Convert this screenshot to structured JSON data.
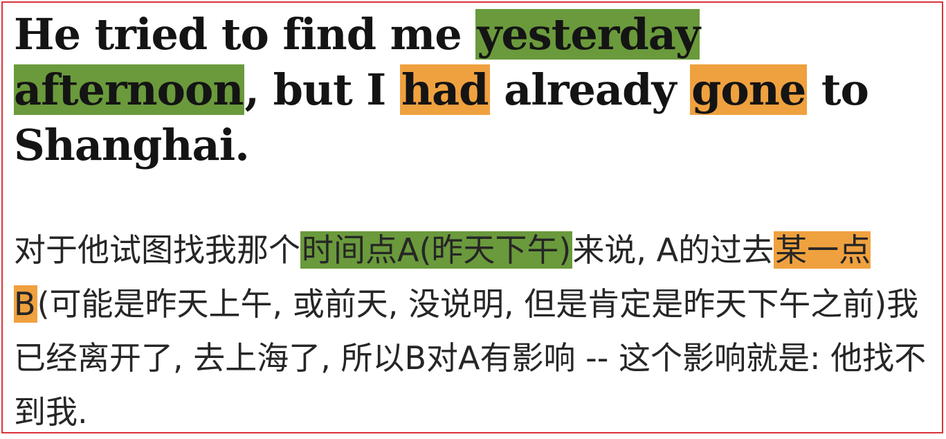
{
  "colors": {
    "border": "#d9323b",
    "highlight_time": "#6a9a3c",
    "highlight_verb": "#efa13f",
    "text": "#141414"
  },
  "english": {
    "seg1": "He tried to find me ",
    "hl_time": "yesterday afternoon",
    "seg2": ", but I ",
    "hl_had": "had",
    "seg3": " already ",
    "hl_gone": "gone",
    "seg4": " to Shanghai."
  },
  "chinese": {
    "seg1": "对于他试图找我那个",
    "hl_point_a": "时间点A(昨天下午)",
    "seg2": "来说, A的过去",
    "hl_point_b": "某一点B",
    "seg3": "(可能是昨天上午, 或前天, 没说明, 但是肯定是昨天下午之前)我已经离开了, 去上海了, 所以B对A有影响 -- 这个影响就是: 他找不到我."
  }
}
